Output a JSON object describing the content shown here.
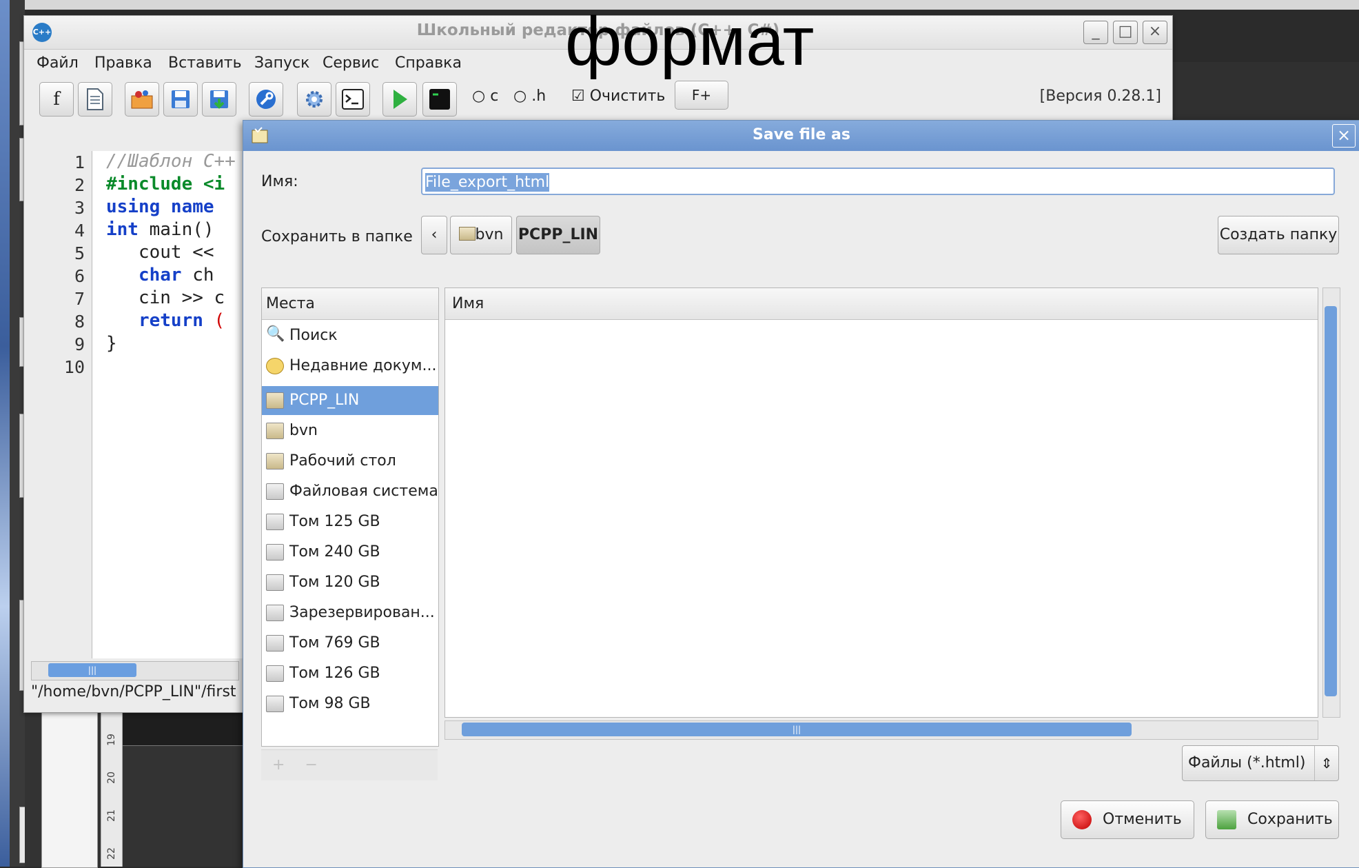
{
  "overlay_heading": "формат",
  "editor": {
    "title": "Школьный редактор файлов (C++, C#)",
    "logo_text": "C++",
    "window_buttons": [
      "_",
      "□",
      "×"
    ],
    "menu": [
      "Файл",
      "Правка",
      "Вставить",
      "Запуск",
      "Сервис",
      "Справка"
    ],
    "toolbar": {
      "font_button": "f",
      "radio_c": "c",
      "radio_h": ".h",
      "clear_checkbox": "Очистить",
      "font_plus": "F+",
      "version": "[Версия 0.28.1]"
    },
    "line_numbers": [
      "1",
      "2",
      "3",
      "4",
      "5",
      "6",
      "7",
      "8",
      "9",
      "10"
    ],
    "code": {
      "l1": "//Шаблон C++",
      "l2": "#include <i",
      "l3a": "using",
      "l3b": " name",
      "l4a": "int",
      "l4b": " main()",
      "l5": "   cout <<",
      "l6a": "   char",
      "l6b": " ch",
      "l7": "   cin >> c",
      "l8a": "   return",
      "l8b": " (",
      "l9": "}"
    },
    "status_path": "\"/home/bvn/PCPP_LIN\"/first"
  },
  "dialog": {
    "title": "Save file as",
    "close": "×",
    "name_label": "Имя:",
    "name_value": "File_export_html",
    "folder_label": "Сохранить в папке",
    "path_back": "‹",
    "path_segments": [
      "bvn",
      "PCPP_LIN"
    ],
    "create_folder": "Создать папку",
    "places_header": "Места",
    "places": [
      {
        "label": "Поиск",
        "icon": "search-icon"
      },
      {
        "label": "Недавние докум...",
        "icon": "recent-icon"
      },
      {
        "label": "PCPP_LIN",
        "icon": "folder-icon",
        "selected": true
      },
      {
        "label": "bvn",
        "icon": "home-folder-icon"
      },
      {
        "label": "Рабочий стол",
        "icon": "desktop-folder-icon"
      },
      {
        "label": "Файловая система",
        "icon": "drive-icon"
      },
      {
        "label": "Том 125 GB",
        "icon": "drive-icon"
      },
      {
        "label": "Том 240 GB",
        "icon": "drive-icon"
      },
      {
        "label": "Том 120 GB",
        "icon": "drive-icon"
      },
      {
        "label": "Зарезервирован...",
        "icon": "drive-icon"
      },
      {
        "label": "Том 769 GB",
        "icon": "drive-icon"
      },
      {
        "label": "Том 126 GB",
        "icon": "drive-icon"
      },
      {
        "label": "Том 98 GB",
        "icon": "drive-icon"
      }
    ],
    "add_place": "+",
    "remove_place": "−",
    "files_header": "Имя",
    "filter": "Файлы (*.html)",
    "cancel": "Отменить",
    "save": "Сохранить"
  },
  "colors": {
    "dialog_title_bg": "#6a94cf",
    "selection": "#6f9fdc",
    "keyword_green": "#0a8a2a",
    "keyword_blue": "#1540c8"
  }
}
